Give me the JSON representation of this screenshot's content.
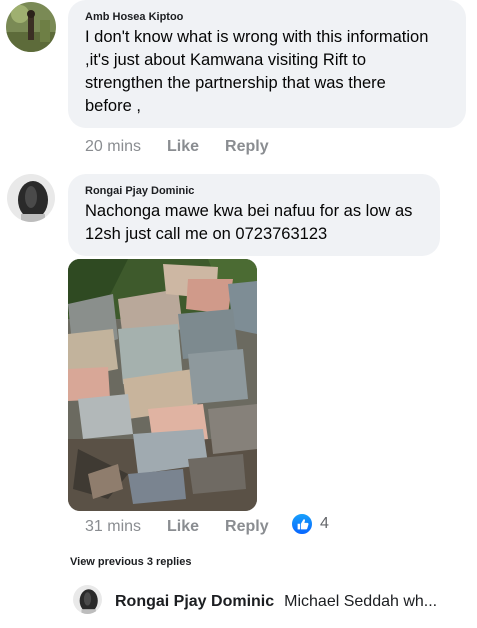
{
  "comments": [
    {
      "author": "Amb Hosea Kiptoo",
      "text_lines": [
        "I don't know what is wrong with this information",
        ",it's just about Kamwana visiting Rift to",
        "strengthen the partnership that was there",
        "before ,"
      ],
      "time": "20 mins",
      "like_label": "Like",
      "reply_label": "Reply"
    },
    {
      "author": "Rongai Pjay Dominic",
      "text_lines": [
        "Nachonga mawe kwa bei nafuu for as low as",
        "12sh just call me on 0723763123"
      ],
      "time": "31 mins",
      "like_label": "Like",
      "reply_label": "Reply",
      "reaction_icon": "thumbs-up-icon",
      "reaction_count": "4"
    }
  ],
  "view_previous_replies": "View previous 3 replies",
  "latest_reply": {
    "author": "Rongai Pjay Dominic",
    "preview": "Michael Seddah wh..."
  },
  "colors": {
    "bubble": "#f0f2f5",
    "meta_text": "#8a8d91",
    "like_blue": "#0866ff"
  }
}
